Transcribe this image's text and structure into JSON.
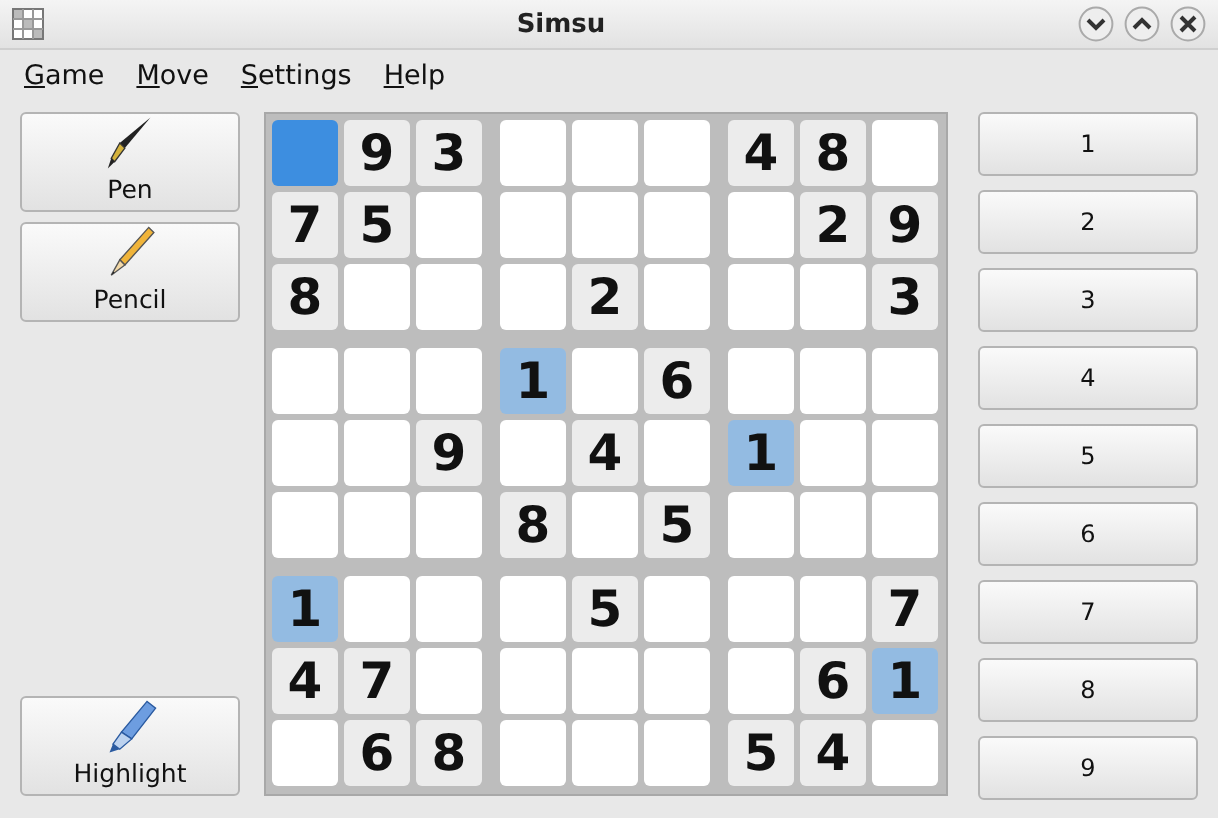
{
  "window": {
    "title": "Simsu"
  },
  "menu": [
    {
      "label": "Game",
      "underline_first": true
    },
    {
      "label": "Move",
      "underline_first": true
    },
    {
      "label": "Settings",
      "underline_first": true
    },
    {
      "label": "Help",
      "underline_first": true
    }
  ],
  "tools": [
    {
      "label": "Pen",
      "kind": "pen"
    },
    {
      "label": "Pencil",
      "kind": "pencil"
    },
    {
      "label": "Highlight",
      "kind": "highlight"
    }
  ],
  "board": [
    [
      {
        "selected": true,
        "highlighted": false
      },
      {
        "value": "9",
        "selected": false,
        "highlighted": false
      },
      {
        "value": "3",
        "selected": false,
        "highlighted": false
      },
      {
        "selected": false,
        "highlighted": false
      },
      {
        "selected": false,
        "highlighted": false
      },
      {
        "selected": false,
        "highlighted": false
      },
      {
        "value": "4",
        "selected": false,
        "highlighted": false
      },
      {
        "value": "8",
        "selected": false,
        "highlighted": false
      },
      {
        "selected": false,
        "highlighted": false
      }
    ],
    [
      {
        "value": "7",
        "selected": false,
        "highlighted": false
      },
      {
        "value": "5",
        "selected": false,
        "highlighted": false
      },
      {
        "selected": false,
        "highlighted": false
      },
      {
        "selected": false,
        "highlighted": false
      },
      {
        "selected": false,
        "highlighted": false
      },
      {
        "selected": false,
        "highlighted": false
      },
      {
        "selected": false,
        "highlighted": false
      },
      {
        "value": "2",
        "selected": false,
        "highlighted": false
      },
      {
        "value": "9",
        "selected": false,
        "highlighted": false
      }
    ],
    [
      {
        "value": "8",
        "selected": false,
        "highlighted": false
      },
      {
        "selected": false,
        "highlighted": false
      },
      {
        "selected": false,
        "highlighted": false
      },
      {
        "selected": false,
        "highlighted": false
      },
      {
        "value": "2",
        "selected": false,
        "highlighted": false
      },
      {
        "selected": false,
        "highlighted": false
      },
      {
        "selected": false,
        "highlighted": false
      },
      {
        "selected": false,
        "highlighted": false
      },
      {
        "value": "3",
        "selected": false,
        "highlighted": false
      }
    ],
    [
      {
        "selected": false,
        "highlighted": false
      },
      {
        "selected": false,
        "highlighted": false
      },
      {
        "selected": false,
        "highlighted": false
      },
      {
        "value": "1",
        "selected": false,
        "highlighted": true
      },
      {
        "selected": false,
        "highlighted": false
      },
      {
        "value": "6",
        "selected": false,
        "highlighted": false
      },
      {
        "selected": false,
        "highlighted": false
      },
      {
        "selected": false,
        "highlighted": false
      },
      {
        "selected": false,
        "highlighted": false
      }
    ],
    [
      {
        "selected": false,
        "highlighted": false
      },
      {
        "selected": false,
        "highlighted": false
      },
      {
        "value": "9",
        "selected": false,
        "highlighted": false
      },
      {
        "selected": false,
        "highlighted": false
      },
      {
        "value": "4",
        "selected": false,
        "highlighted": false
      },
      {
        "selected": false,
        "highlighted": false
      },
      {
        "value": "1",
        "selected": false,
        "highlighted": true
      },
      {
        "selected": false,
        "highlighted": false
      },
      {
        "selected": false,
        "highlighted": false
      }
    ],
    [
      {
        "selected": false,
        "highlighted": false
      },
      {
        "selected": false,
        "highlighted": false
      },
      {
        "selected": false,
        "highlighted": false
      },
      {
        "value": "8",
        "selected": false,
        "highlighted": false
      },
      {
        "selected": false,
        "highlighted": false
      },
      {
        "value": "5",
        "selected": false,
        "highlighted": false
      },
      {
        "selected": false,
        "highlighted": false
      },
      {
        "selected": false,
        "highlighted": false
      },
      {
        "selected": false,
        "highlighted": false
      }
    ],
    [
      {
        "value": "1",
        "selected": false,
        "highlighted": true
      },
      {
        "selected": false,
        "highlighted": false
      },
      {
        "selected": false,
        "highlighted": false
      },
      {
        "selected": false,
        "highlighted": false
      },
      {
        "value": "5",
        "selected": false,
        "highlighted": false
      },
      {
        "selected": false,
        "highlighted": false
      },
      {
        "selected": false,
        "highlighted": false
      },
      {
        "selected": false,
        "highlighted": false
      },
      {
        "value": "7",
        "selected": false,
        "highlighted": false
      }
    ],
    [
      {
        "value": "4",
        "selected": false,
        "highlighted": false
      },
      {
        "value": "7",
        "selected": false,
        "highlighted": false
      },
      {
        "selected": false,
        "highlighted": false
      },
      {
        "selected": false,
        "highlighted": false
      },
      {
        "selected": false,
        "highlighted": false
      },
      {
        "selected": false,
        "highlighted": false
      },
      {
        "selected": false,
        "highlighted": false
      },
      {
        "value": "6",
        "selected": false,
        "highlighted": false
      },
      {
        "value": "1",
        "selected": false,
        "highlighted": true
      }
    ],
    [
      {
        "selected": false,
        "highlighted": false
      },
      {
        "value": "6",
        "selected": false,
        "highlighted": false
      },
      {
        "value": "8",
        "selected": false,
        "highlighted": false
      },
      {
        "selected": false,
        "highlighted": false
      },
      {
        "selected": false,
        "highlighted": false
      },
      {
        "selected": false,
        "highlighted": false
      },
      {
        "value": "5",
        "selected": false,
        "highlighted": false
      },
      {
        "value": "4",
        "selected": false,
        "highlighted": false
      },
      {
        "selected": false,
        "highlighted": false
      }
    ]
  ],
  "number_buttons": [
    "1",
    "2",
    "3",
    "4",
    "5",
    "6",
    "7",
    "8",
    "9"
  ]
}
